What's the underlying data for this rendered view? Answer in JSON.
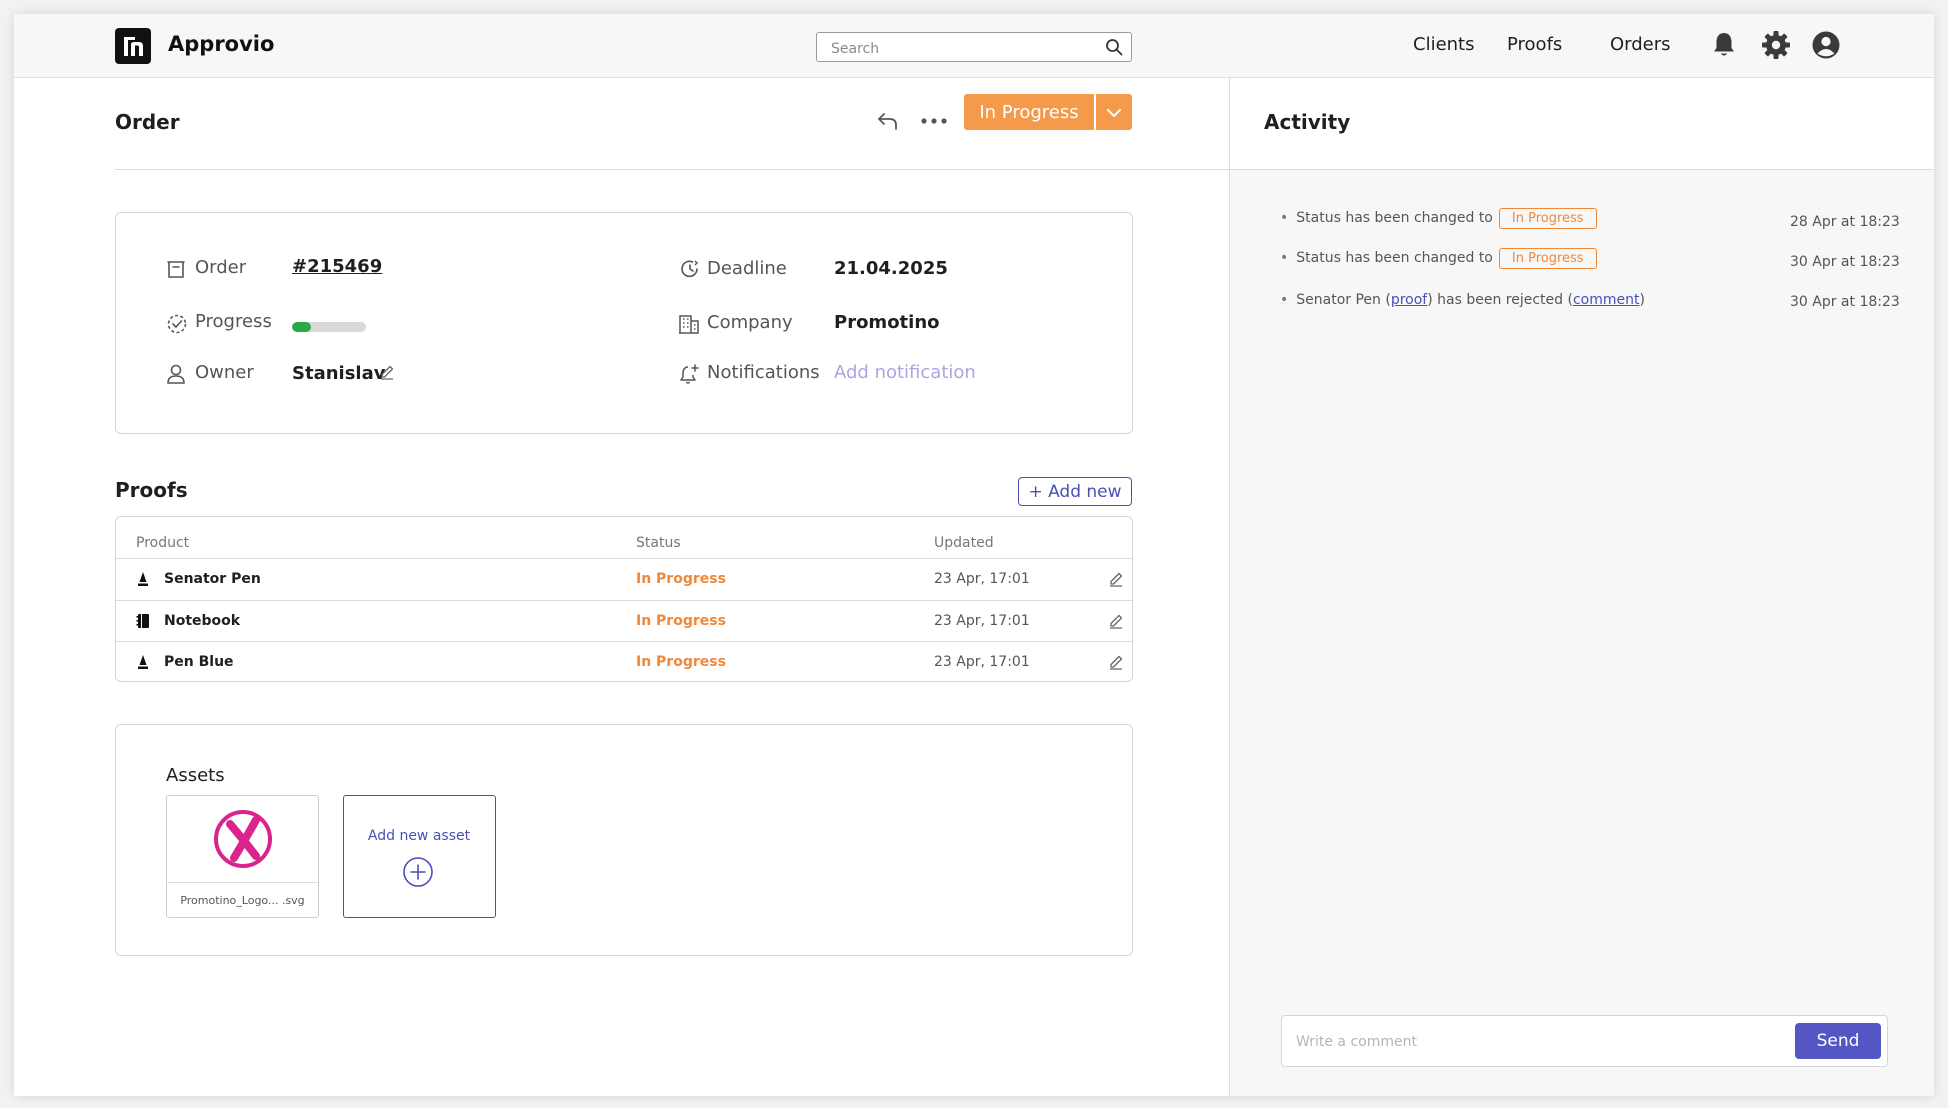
{
  "app": {
    "name": "Approvio"
  },
  "search": {
    "placeholder": "Search"
  },
  "nav": {
    "links": [
      "Clients",
      "Proofs",
      "Orders"
    ]
  },
  "order": {
    "title": "Order",
    "status_button": "In Progress",
    "fields": {
      "order_label": "Order",
      "order_number": "#215469",
      "progress_label": "Progress",
      "progress_fraction": 0.25,
      "owner_label": "Owner",
      "owner_value": "Stanislav",
      "deadline_label": "Deadline",
      "deadline_value": "21.04.2025",
      "company_label": "Company",
      "company_value": "Promotino",
      "notifications_label": "Notifications",
      "add_notification": "Add notification"
    }
  },
  "proofs": {
    "title": "Proofs",
    "add_new": "+ Add new",
    "columns": [
      "Product",
      "Status",
      "Updated"
    ],
    "rows": [
      {
        "product": "Senator Pen",
        "icon": "pen-icon",
        "status": "In Progress",
        "updated": "23 Apr, 17:01"
      },
      {
        "product": "Notebook",
        "icon": "notebook-icon",
        "status": "In Progress",
        "updated": "23 Apr, 17:01"
      },
      {
        "product": "Pen Blue",
        "icon": "pen-icon",
        "status": "In Progress",
        "updated": "23 Apr, 17:01"
      }
    ]
  },
  "assets": {
    "title": "Assets",
    "items": [
      {
        "filename": "Promotino_Logo... .svg"
      }
    ],
    "add_label": "Add new asset"
  },
  "activity": {
    "title": "Activity",
    "items": [
      {
        "text": "Status has been changed to",
        "pill": "In Progress",
        "time": "28 Apr at 18:23"
      },
      {
        "text": "Status has been changed to",
        "pill": "In Progress",
        "time": "30 Apr at 18:23"
      },
      {
        "prefix": "Senator Pen (",
        "link1": "proof",
        "middle": ") has been rejected (",
        "link2": "comment",
        "suffix": ")",
        "time": "30 Apr at 18:23"
      }
    ],
    "comment_placeholder": "Write a comment",
    "send": "Send"
  },
  "colors": {
    "accent_orange": "#f59a4a",
    "status_orange": "#f0883a",
    "brand_purple": "#4a4fb8",
    "send_purple": "#5456c4",
    "progress_green": "#2aa84a",
    "logo_pink": "#d8248c"
  }
}
